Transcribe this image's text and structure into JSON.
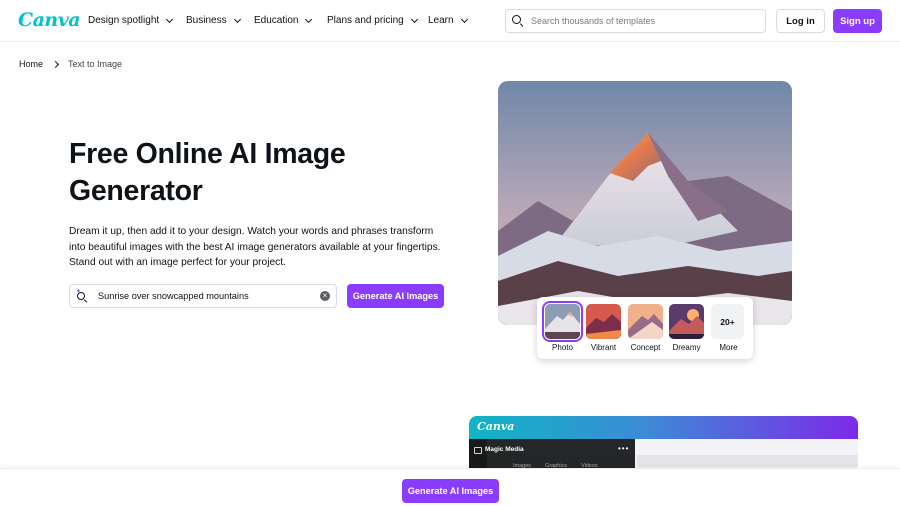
{
  "nav": {
    "logo": "Canva",
    "items": [
      {
        "label": "Design spotlight"
      },
      {
        "label": "Business"
      },
      {
        "label": "Education"
      },
      {
        "label": "Plans and pricing"
      },
      {
        "label": "Learn"
      }
    ],
    "search_placeholder": "Search thousands of templates",
    "login_label": "Log in",
    "signup_label": "Sign up"
  },
  "breadcrumb": {
    "home": "Home",
    "current": "Text to Image"
  },
  "hero": {
    "title": "Free Online AI Image Generator",
    "description": "Dream it up, then add it to your design. Watch your words and phrases transform into beautiful images with the best AI image generators available at your fingertips. Stand out with an image perfect for your project.",
    "prompt_value": "Sunrise over snowcapped mountains",
    "generate_label": "Generate AI Images"
  },
  "styles": {
    "items": [
      {
        "label": "Photo",
        "selected": true
      },
      {
        "label": "Vibrant",
        "selected": false
      },
      {
        "label": "Concept",
        "selected": false
      },
      {
        "label": "Dreamy",
        "selected": false
      }
    ],
    "more_count": "20+",
    "more_label": "More"
  },
  "editor_preview": {
    "logo": "Canva",
    "panel_title": "Magic Media",
    "tabs": [
      "Images",
      "Graphics",
      "Videos"
    ]
  },
  "sticky": {
    "generate_label": "Generate AI Images"
  },
  "colors": {
    "brand_purple": "#8b3dff",
    "brand_teal": "#00c4cc"
  }
}
